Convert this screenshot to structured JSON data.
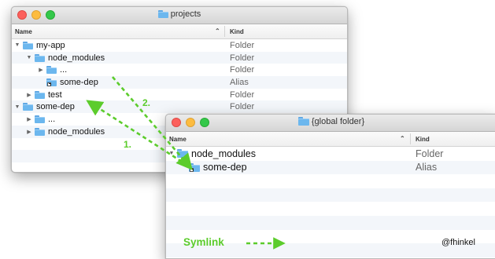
{
  "colors": {
    "accent": "#5ccc2c",
    "folder": "#6cb7ee"
  },
  "window1": {
    "title": "projects",
    "columns": {
      "name": "Name",
      "kind": "Kind"
    },
    "rows": [
      {
        "label": "my-app",
        "kind": "Folder",
        "icon": "folder-icon",
        "expanded": true,
        "depth": 0
      },
      {
        "label": "node_modules",
        "kind": "Folder",
        "icon": "folder-icon",
        "expanded": true,
        "depth": 1
      },
      {
        "label": "...",
        "kind": "Folder",
        "icon": "folder-icon",
        "expanded": false,
        "depth": 2
      },
      {
        "label": "some-dep",
        "kind": "Alias",
        "icon": "alias-folder-icon",
        "expanded": null,
        "depth": 2
      },
      {
        "label": "test",
        "kind": "Folder",
        "icon": "folder-icon",
        "expanded": false,
        "depth": 1
      },
      {
        "label": "some-dep",
        "kind": "Folder",
        "icon": "folder-icon",
        "expanded": true,
        "depth": 0
      },
      {
        "label": "...",
        "kind": "Folder",
        "icon": "folder-icon",
        "expanded": false,
        "depth": 1
      },
      {
        "label": "node_modules",
        "kind": "",
        "icon": "folder-icon",
        "expanded": false,
        "depth": 1
      },
      {
        "label": "",
        "kind": "",
        "icon": "",
        "expanded": null,
        "depth": 0
      },
      {
        "label": "",
        "kind": "",
        "icon": "",
        "expanded": null,
        "depth": 0
      },
      {
        "label": "",
        "kind": "",
        "icon": "",
        "expanded": null,
        "depth": 0
      }
    ]
  },
  "window2": {
    "title": "{global folder}",
    "columns": {
      "name": "Name",
      "kind": "Kind"
    },
    "rows": [
      {
        "label": "node_modules",
        "kind": "Folder",
        "icon": "folder-icon",
        "expanded": true,
        "depth": 0
      },
      {
        "label": "some-dep",
        "kind": "Alias",
        "icon": "alias-folder-icon",
        "expanded": null,
        "depth": 1
      },
      {
        "label": "",
        "kind": "",
        "icon": "",
        "expanded": null,
        "depth": 0
      },
      {
        "label": "",
        "kind": "",
        "icon": "",
        "expanded": null,
        "depth": 0
      },
      {
        "label": "",
        "kind": "",
        "icon": "",
        "expanded": null,
        "depth": 0
      },
      {
        "label": "",
        "kind": "",
        "icon": "",
        "expanded": null,
        "depth": 0
      },
      {
        "label": "",
        "kind": "",
        "icon": "",
        "expanded": null,
        "depth": 0
      },
      {
        "label": "",
        "kind": "",
        "icon": "",
        "expanded": null,
        "depth": 0
      }
    ]
  },
  "annotations": {
    "arrow1_label": "1.",
    "arrow2_label": "2.",
    "legend": "Symlink",
    "credit": "@fhinkel"
  }
}
